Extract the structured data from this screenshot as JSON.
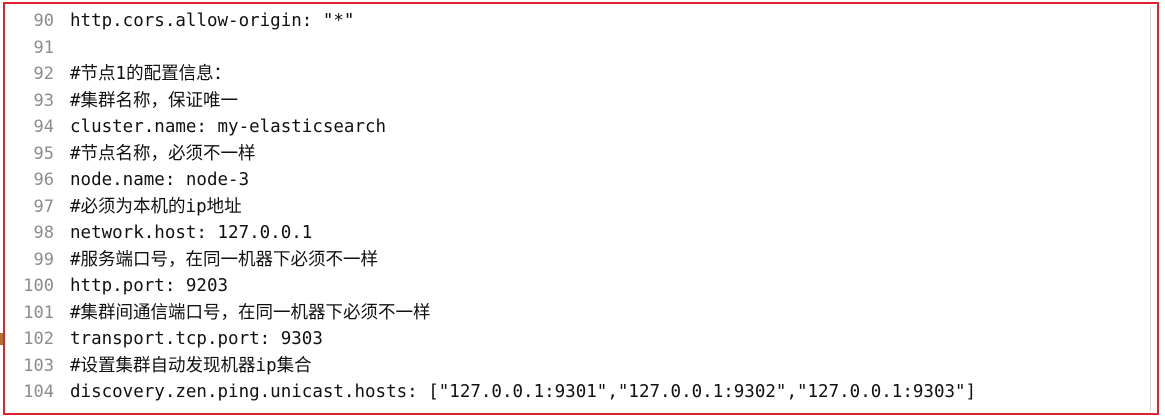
{
  "editor": {
    "lines": [
      {
        "num": "90",
        "text": "http.cors.allow-origin: \"*\""
      },
      {
        "num": "91",
        "text": ""
      },
      {
        "num": "92",
        "text": "#节点1的配置信息："
      },
      {
        "num": "93",
        "text": "#集群名称，保证唯一"
      },
      {
        "num": "94",
        "text": "cluster.name: my-elasticsearch"
      },
      {
        "num": "95",
        "text": "#节点名称，必须不一样"
      },
      {
        "num": "96",
        "text": "node.name: node-3"
      },
      {
        "num": "97",
        "text": "#必须为本机的ip地址"
      },
      {
        "num": "98",
        "text": "network.host: 127.0.0.1"
      },
      {
        "num": "99",
        "text": "#服务端口号，在同一机器下必须不一样"
      },
      {
        "num": "100",
        "text": "http.port: 9203"
      },
      {
        "num": "101",
        "text": "#集群间通信端口号，在同一机器下必须不一样"
      },
      {
        "num": "102",
        "text": "transport.tcp.port: 9303"
      },
      {
        "num": "103",
        "text": "#设置集群自动发现机器ip集合"
      },
      {
        "num": "104",
        "text": "discovery.zen.ping.unicast.hosts: [\"127.0.0.1:9301\",\"127.0.0.1:9302\",\"127.0.0.1:9303\"]"
      }
    ]
  },
  "colors": {
    "frame_border": "#e0212f",
    "line_number": "#8c8c8c",
    "text": "#111111"
  }
}
